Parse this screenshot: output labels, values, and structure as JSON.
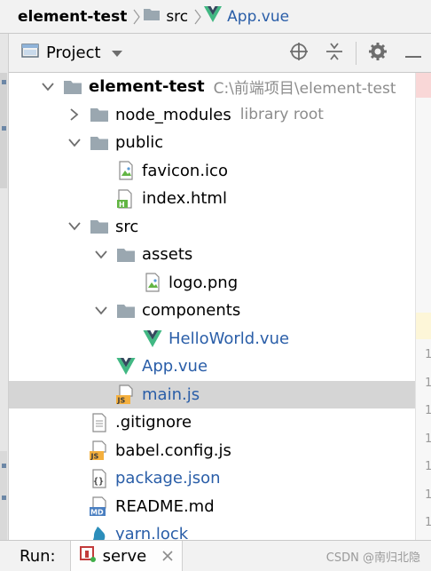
{
  "breadcrumb": {
    "items": [
      {
        "label": "element-test",
        "icon": "folder-icon"
      },
      {
        "label": "src",
        "icon": "folder-icon"
      },
      {
        "label": "App.vue",
        "icon": "vue-icon"
      }
    ]
  },
  "panel": {
    "title": "Project",
    "tools": [
      "locate-icon",
      "collapse-all-icon",
      "settings-icon",
      "minimize-icon"
    ]
  },
  "tree": [
    {
      "name": "element-test",
      "hint": "C:\\前端项目\\element-test",
      "depth": 0,
      "expanded": true,
      "kind": "folder"
    },
    {
      "name": "node_modules",
      "hint": "library root",
      "depth": 1,
      "expanded": false,
      "kind": "folder"
    },
    {
      "name": "public",
      "hint": "",
      "depth": 1,
      "expanded": true,
      "kind": "folder"
    },
    {
      "name": "favicon.ico",
      "hint": "",
      "depth": 2,
      "kind": "image"
    },
    {
      "name": "index.html",
      "hint": "",
      "depth": 2,
      "kind": "html"
    },
    {
      "name": "src",
      "hint": "",
      "depth": 1,
      "expanded": true,
      "kind": "folder"
    },
    {
      "name": "assets",
      "hint": "",
      "depth": 2,
      "expanded": true,
      "kind": "folder"
    },
    {
      "name": "logo.png",
      "hint": "",
      "depth": 3,
      "kind": "image"
    },
    {
      "name": "components",
      "hint": "",
      "depth": 2,
      "expanded": true,
      "kind": "folder"
    },
    {
      "name": "HelloWorld.vue",
      "hint": "",
      "depth": 3,
      "kind": "vue"
    },
    {
      "name": "App.vue",
      "hint": "",
      "depth": 2,
      "kind": "vue"
    },
    {
      "name": "main.js",
      "hint": "",
      "depth": 2,
      "kind": "js",
      "selected": true
    },
    {
      "name": ".gitignore",
      "hint": "",
      "depth": 1,
      "kind": "text"
    },
    {
      "name": "babel.config.js",
      "hint": "",
      "depth": 1,
      "kind": "js"
    },
    {
      "name": "package.json",
      "hint": "",
      "depth": 1,
      "kind": "json"
    },
    {
      "name": "README.md",
      "hint": "",
      "depth": 1,
      "kind": "md"
    },
    {
      "name": "yarn.lock",
      "hint": "",
      "depth": 1,
      "kind": "yarn"
    }
  ],
  "gutter": {
    "numbers": [
      "1",
      "1",
      "1",
      "1",
      "1",
      "1",
      "1"
    ]
  },
  "run": {
    "label": "Run:",
    "tab": "serve"
  },
  "watermark": "CSDN @南归北隐",
  "colors": {
    "vue_green": "#41b883",
    "vue_dark": "#34495e",
    "link_blue": "#2a5ea8",
    "folder_gray": "#9aa7b0",
    "selection": "#d5d5d5"
  }
}
